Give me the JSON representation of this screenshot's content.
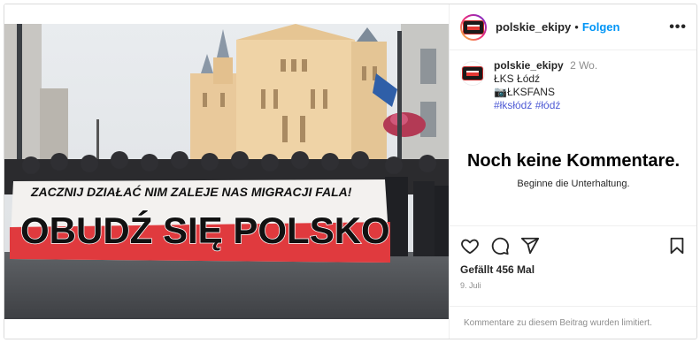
{
  "header": {
    "username": "polskie_ekipy",
    "separator": "•",
    "follow_label": "Folgen",
    "more_label": "•••"
  },
  "caption": {
    "username": "polskie_ekipy",
    "time": "2 Wo.",
    "lines": [
      "ŁKS Łódź",
      "📷ŁKSFANS"
    ],
    "hashtags": "#łksłódź #łódź"
  },
  "photo": {
    "banner_top_text": "ZACZNIJ DZIAŁAĆ NIM ZALEJE NAS MIGRACJI FALA!",
    "banner_main_text": "OBUDŹ SIĘ POLSKO"
  },
  "comments": {
    "empty_title": "Noch keine Kommentare.",
    "empty_subtitle": "Beginne die Unterhaltung."
  },
  "actions": {
    "likes": "Gefällt 456 Mal",
    "date": "9. Juli",
    "icons": [
      "heart-icon",
      "comment-icon",
      "share-icon",
      "bookmark-icon"
    ]
  },
  "footer": {
    "limited_text": "Kommentare zu diesem Beitrag wurden limitiert."
  },
  "colors": {
    "follow_blue": "#0095f6",
    "hashtag_blue": "#4f5bd5",
    "banner_red": "#e03a3e"
  }
}
